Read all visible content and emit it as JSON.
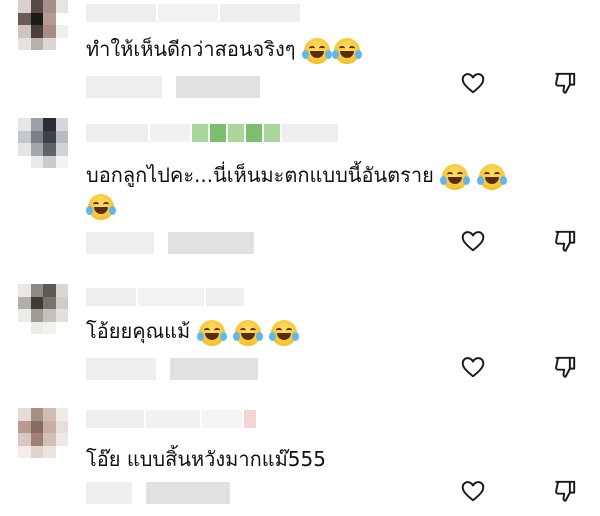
{
  "comments": [
    {
      "text": "ทำให้เห็นดีกว่าสอนจริงๆ",
      "emojis": [
        "face-with-tears-of-joy",
        "face-with-tears-of-joy"
      ],
      "avatar_colors": [
        "#d7d2cf",
        "#5a4a45",
        "#a7908a",
        "#e9e4e2",
        "#6d5b57",
        "#1d1a19",
        "#b79c94",
        "#ffffff",
        "#cfc6c2",
        "#4a3d3a",
        "#a88c85",
        "#f1efee",
        "#e6e2e0",
        "#b9b0ad",
        "#ddd6d3",
        "#ffffff"
      ]
    },
    {
      "text": "บอกลูกไปคะ...นี่เห็นมะตกแบบนี้อันตราย",
      "emojis": [
        "face-with-tears-of-joy",
        "face-with-tears-of-joy",
        "face-with-tears-of-joy"
      ],
      "avatar_colors": [
        "#e7e7e7",
        "#9c9fa3",
        "#2a2d33",
        "#d5d6d8",
        "#c5c8cc",
        "#7a7f86",
        "#3d4149",
        "#b8bbbf",
        "#e3e4e6",
        "#a4a8ad",
        "#5f646b",
        "#d0d2d5",
        "#ffffff",
        "#e9eaeb",
        "#c9cbce",
        "#f3f3f4"
      ]
    },
    {
      "text": "โอ้ยยคุณแม้",
      "emojis": [
        "face-with-tears-of-joy",
        "face-with-tears-of-joy",
        "face-with-tears-of-joy"
      ],
      "avatar_colors": [
        "#e9e8e6",
        "#8e8a84",
        "#5c5852",
        "#d9d7d4",
        "#b2aea8",
        "#3e3b37",
        "#77736d",
        "#cfccc8",
        "#ecebe9",
        "#9f9b95",
        "#c4c1bc",
        "#e2e0dd",
        "#ffffff",
        "#ecebe9",
        "#f2f1f0",
        "#ffffff"
      ]
    },
    {
      "text": "โอ๊ย แบบสิ้นหวังมากแม๊555",
      "emojis": [],
      "avatar_colors": [
        "#e4dcd8",
        "#a88f86",
        "#cfbcb4",
        "#f2ece9",
        "#b79a90",
        "#8a6b61",
        "#c9aea4",
        "#e8dfdb",
        "#d9c8c1",
        "#9e8077",
        "#d4bfb7",
        "#efe8e5",
        "#f3eeec",
        "#e0d4cf",
        "#ece4e0",
        "#ffffff"
      ]
    }
  ],
  "icons": {
    "like": "heart-outline-icon",
    "dislike": "thumbs-down-outline-icon"
  },
  "colors": {
    "icon_stroke": "#1a1a1a",
    "blur_gray": "#eeeeee",
    "name_green": "#7bbf6e"
  }
}
